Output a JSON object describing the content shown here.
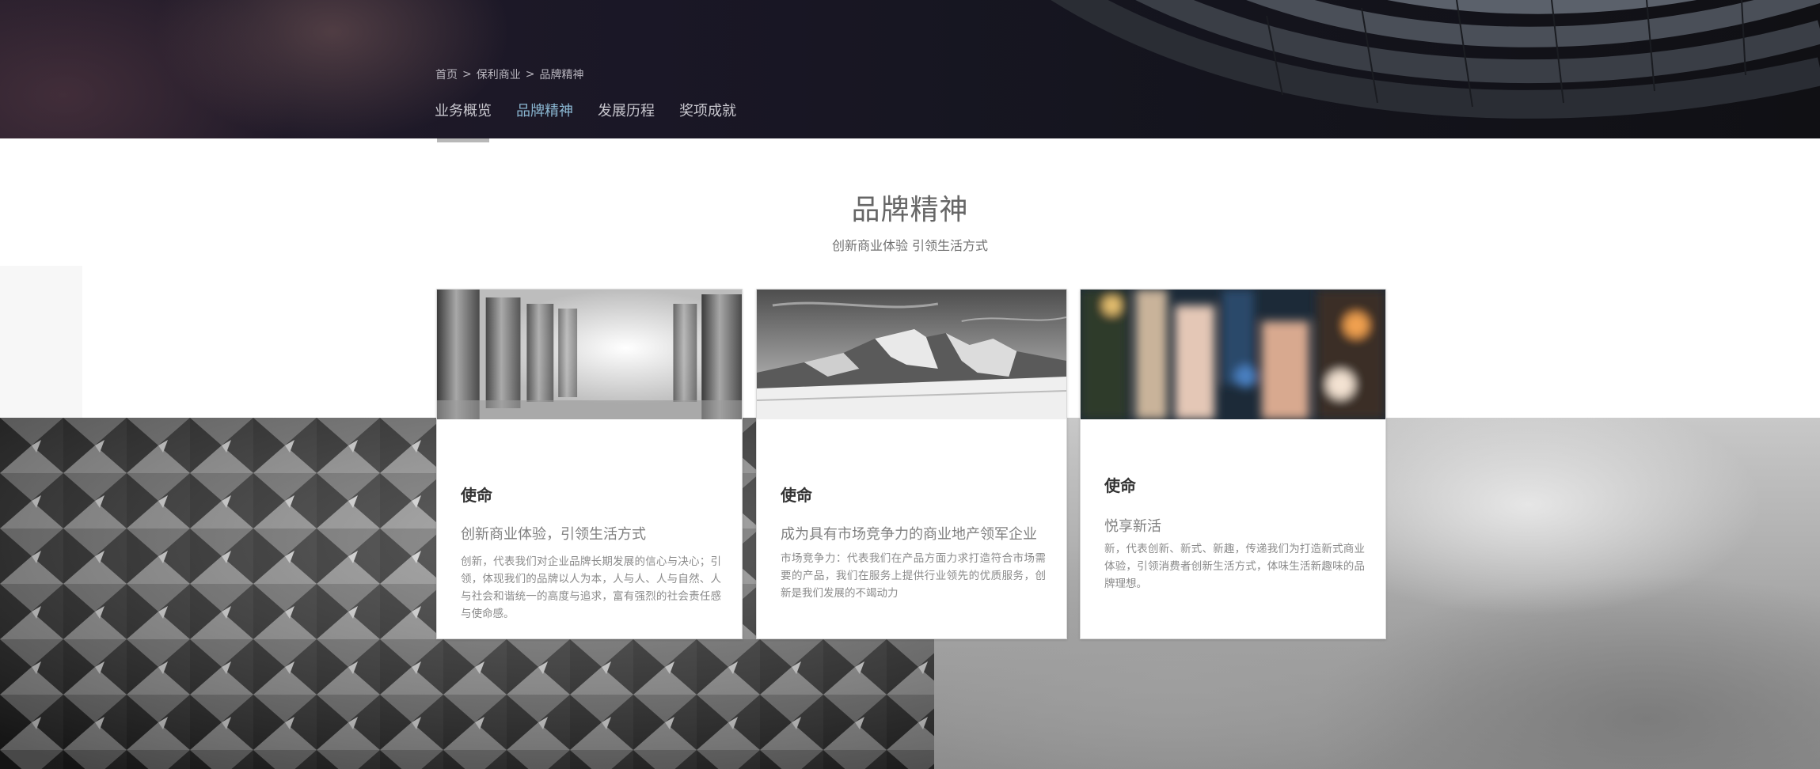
{
  "breadcrumb": {
    "items": [
      "首页",
      "保利商业",
      "品牌精神"
    ],
    "separator": ">"
  },
  "tabs": [
    {
      "label": "业务概览",
      "active": false
    },
    {
      "label": "品牌精神",
      "active": true
    },
    {
      "label": "发展历程",
      "active": false
    },
    {
      "label": "奖项成就",
      "active": false
    }
  ],
  "section": {
    "title": "品牌精神",
    "subtitle": "创新商业体验 引领生活方式"
  },
  "cards": [
    {
      "heading": "使命",
      "tagline": "创新商业体验，引领生活方式",
      "text": "创新，代表我们对企业品牌长期发展的信心与决心；引领，体现我们的品牌以人为本，人与人、人与自然、人与社会和谐统一的高度与追求，富有强烈的社会责任感与使命感。",
      "image": "columns-photo"
    },
    {
      "heading": "使命",
      "tagline": "成为具有市场竞争力的商业地产领军企业",
      "text": "市场竞争力：代表我们在产品方面力求打造符合市场需要的产品，我们在服务上提供行业领先的优质服务，创新是我们发展的不竭动力",
      "image": "mountain-photo"
    },
    {
      "heading": "使命",
      "tagline": "悦享新活",
      "text": "新，代表创新、新式、新趣，传递我们为打造新式商业体验，引领消费者创新生活方式，体味生活新趣味的品牌理想。",
      "image": "blurred-city-lights-photo"
    }
  ],
  "colors": {
    "active_tab": "#8ab6d1",
    "tab": "#c9c8cf",
    "title": "#666666",
    "card_heading": "#333333"
  }
}
